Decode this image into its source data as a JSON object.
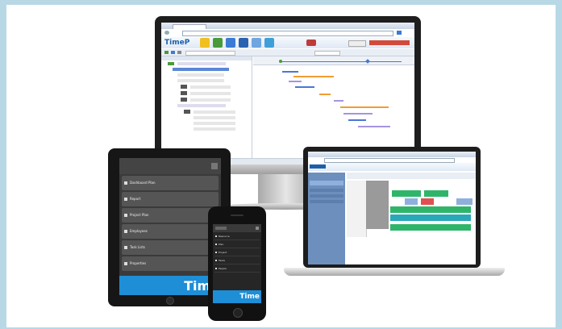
{
  "brand": {
    "logo_text": "Time",
    "monitor_logo_text": "TimeP"
  },
  "tablet": {
    "menu": [
      {
        "label": "Dashboard Plan",
        "icon": "calendar-icon"
      },
      {
        "label": "Report",
        "icon": "document-icon"
      },
      {
        "label": "Project Plan",
        "icon": "chart-icon"
      },
      {
        "label": "Employees",
        "icon": "people-icon"
      },
      {
        "label": "Task Lists",
        "icon": "list-icon"
      },
      {
        "label": "Properties",
        "icon": "settings-icon"
      }
    ]
  },
  "phone": {
    "menu": [
      {
        "label": "Resource",
        "icon": "menu-icon"
      },
      {
        "label": "Plan",
        "icon": "calendar-icon"
      },
      {
        "label": "Project",
        "icon": "chart-icon"
      },
      {
        "label": "Tasks",
        "icon": "list-icon"
      },
      {
        "label": "People",
        "icon": "people-icon"
      }
    ]
  },
  "colors": {
    "accent_blue": "#1e8ed6",
    "gantt_blue": "#4a76d6",
    "gantt_orange": "#f29c33",
    "gantt_purple": "#a694e0",
    "sched_green": "#2fb56a",
    "sched_teal": "#29a8b8",
    "sched_red": "#e05050"
  }
}
